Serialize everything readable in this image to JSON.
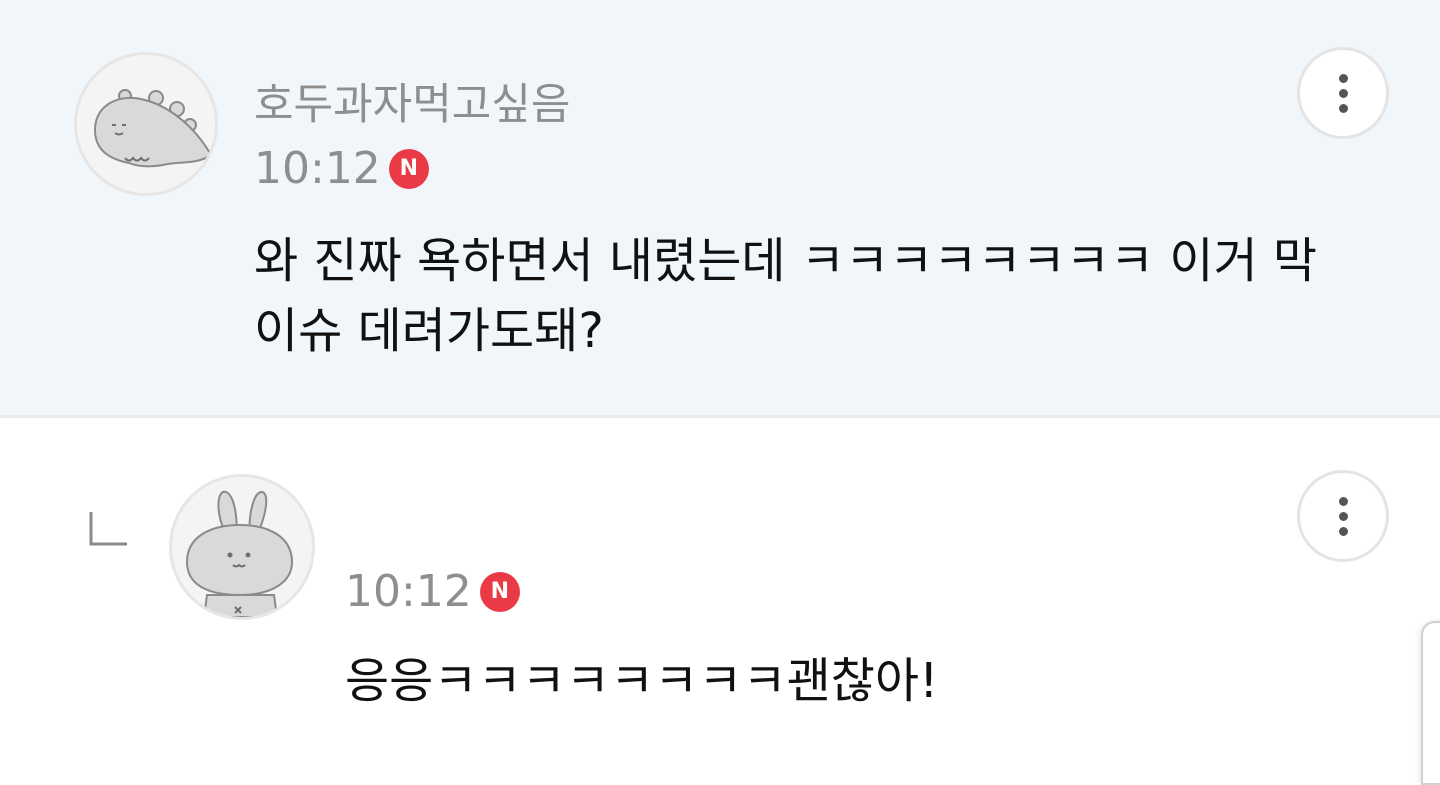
{
  "comments": [
    {
      "nickname": "호두과자먹고싶음",
      "time": "10:12",
      "badge": "N",
      "text": "와 진짜 욕하면서 내렸는데 ㅋㅋㅋㅋㅋㅋㅋㅋ 이거 막이슈 데려가도돼?",
      "avatar_icon": "dinosaur-avatar-icon"
    },
    {
      "time": "10:12",
      "badge": "N",
      "text": "응응ㅋㅋㅋㅋㅋㅋㅋㅋ괜찮아!",
      "avatar_icon": "rabbit-avatar-icon",
      "is_reply": true
    }
  ],
  "colors": {
    "parent_background": "#f1f6fb",
    "new_badge": "#ea3a46",
    "meta_text": "#8e8e8e"
  }
}
